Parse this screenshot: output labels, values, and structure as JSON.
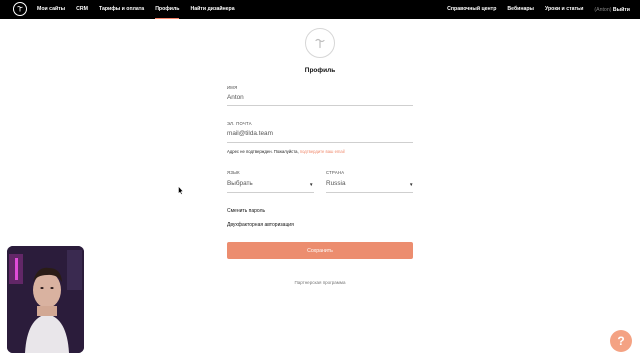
{
  "topbar": {
    "nav_left": [
      "Мои сайты",
      "CRM",
      "Тарифы и оплата",
      "Профиль",
      "Найти дизайнера"
    ],
    "active_index": 3,
    "nav_right": [
      "Справочный центр",
      "Вебинары",
      "Уроки и статьи"
    ],
    "account_name": "(Anton)",
    "logout": "Выйти"
  },
  "page": {
    "title": "Профиль"
  },
  "form": {
    "name_label": "ИМЯ",
    "name_value": "Anton",
    "email_label": "ЭЛ. ПОЧТА",
    "email_value": "mail@tilda.team",
    "email_note": "Адрес не подтвержден. Пожалуйста,",
    "email_confirm_link": "подтвердите ваш email",
    "language_label": "ЯЗЫК",
    "language_value": "Выбрать",
    "country_label": "СТРАНА",
    "country_value": "Russia",
    "change_password": "Сменить пароль",
    "two_factor": "Двухфакторная авторизация",
    "save": "Сохранить"
  },
  "footer": {
    "partner": "Партнерская программа"
  },
  "help": {
    "label": "?"
  },
  "colors": {
    "accent": "#ec8d6f",
    "topbar": "#000000",
    "help_button": "#f4a283"
  }
}
